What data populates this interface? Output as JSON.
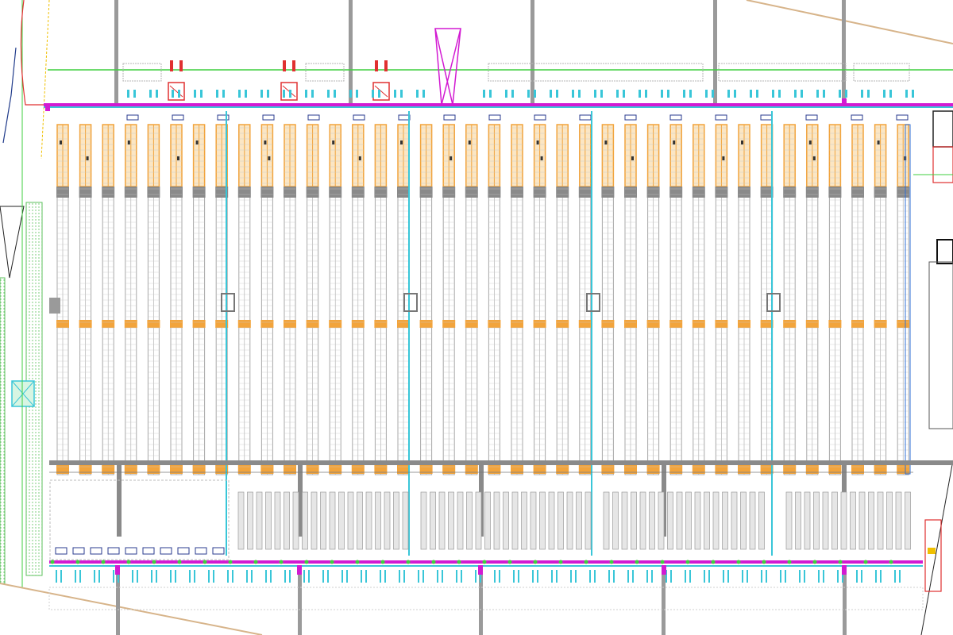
{
  "drawing": {
    "type": "warehouse racking layout (CAD plan)",
    "colors": {
      "background": "#ffffff",
      "rack_frame": "#a8a8a8",
      "rack_beam_orange": "#f2a43c",
      "aisle_gray": "#8a8a8a",
      "dock_line_cyan": "#39c6d8",
      "conveyor_magenta": "#d21ad2",
      "green_line": "#3fcf3f",
      "red_equipment": "#e03030",
      "blue_beam": "#2f6fd6",
      "landscape_hatch": "#5cc25c",
      "boundary_tan": "#d7b48a",
      "dark_pallet": "#333333"
    },
    "icons": [
      "fire-truck-icon",
      "dock-door-icon",
      "pallet-icon"
    ]
  }
}
